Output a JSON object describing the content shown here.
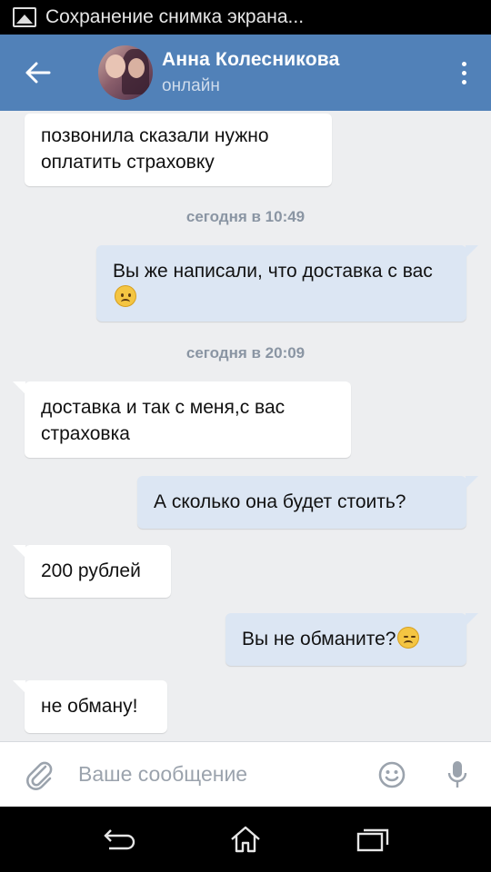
{
  "status_bar": {
    "notification_text": "Сохранение снимка экрана..."
  },
  "header": {
    "peer_name": "Анна Колесникова",
    "peer_status": "онлайн",
    "back_icon": "arrow-left-icon",
    "menu_icon": "more-vertical-icon",
    "color": "#5181b8"
  },
  "messages": [
    {
      "direction": "in",
      "text": "позвонила сказали нужно оплатить страховку"
    },
    {
      "type": "date",
      "text": "сегодня в 10:49"
    },
    {
      "direction": "out",
      "text": "Вы же написали, что доставка с вас",
      "emoji": "slightly-frowning-face"
    },
    {
      "type": "date",
      "text": "сегодня в 20:09"
    },
    {
      "direction": "in",
      "text": "доставка и так с меня,с вас страховка"
    },
    {
      "direction": "out",
      "text": "А сколько она будет стоить?"
    },
    {
      "direction": "in",
      "text": "200 рублей"
    },
    {
      "direction": "out",
      "text": "Вы не обманите?",
      "emoji": "pensive-face"
    },
    {
      "direction": "in",
      "text": "не обману!"
    }
  ],
  "composer": {
    "placeholder": "Ваше сообщение",
    "attach_icon": "paperclip-icon",
    "emoji_icon": "smiley-icon",
    "mic_icon": "microphone-icon"
  },
  "nav_bar": {
    "back": "back-icon",
    "home": "home-icon",
    "recents": "recents-icon"
  },
  "colors": {
    "chat_bg": "#edeef0",
    "outgoing_bubble": "#dce6f3",
    "incoming_bubble": "#ffffff",
    "date_text": "#8a95a3"
  }
}
